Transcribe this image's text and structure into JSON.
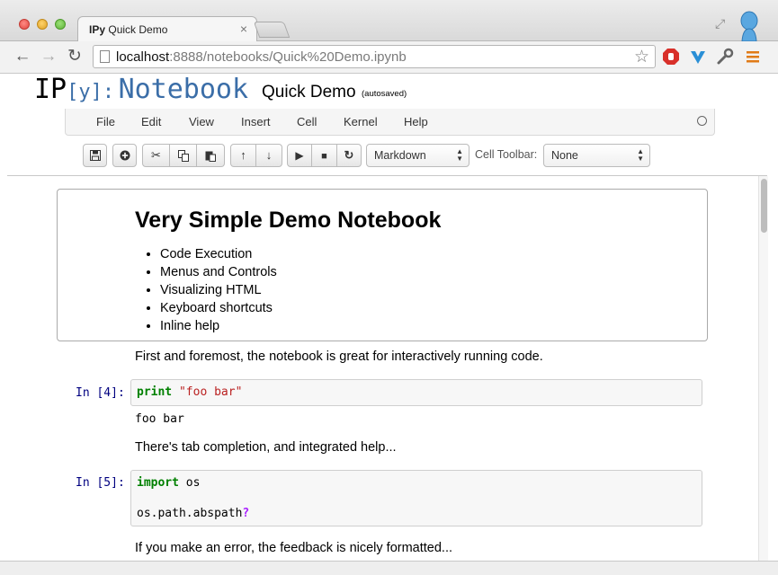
{
  "browser": {
    "tab": {
      "brand": "IPy",
      "title": "Quick Demo"
    },
    "url": {
      "host": "localhost",
      "rest": ":8888/notebooks/Quick%20Demo.ipynb"
    },
    "colors": {
      "close": "#e0443e",
      "minimize": "#dea123",
      "zoom": "#5fb13a"
    },
    "icons": [
      "back-icon",
      "forward-icon",
      "reload-icon",
      "bookmark-star-icon",
      "adblock-icon",
      "extension-v-icon",
      "wrench-icon",
      "chrome-menu-icon"
    ]
  },
  "header": {
    "logo_ip": "IP",
    "logo_y": "[y]:",
    "logo_notebook": "Notebook",
    "notebook_name": "Quick Demo",
    "save_status": "(autosaved)"
  },
  "menu": {
    "items": [
      "File",
      "Edit",
      "View",
      "Insert",
      "Cell",
      "Kernel",
      "Help"
    ]
  },
  "toolbar": {
    "cell_type": "Markdown",
    "cell_toolbar_label": "Cell Toolbar:",
    "cell_toolbar_value": "None"
  },
  "notebook": {
    "markdown_title": "Very Simple Demo Notebook",
    "markdown_list": [
      "Code Execution",
      "Menus and Controls",
      "Visualizing HTML",
      "Keyboard shortcuts",
      "Inline help"
    ],
    "text1": "First and foremost, the notebook is great for interactively running code.",
    "cell4": {
      "prompt": "In [4]:",
      "keyword": "print",
      "string": "\"foo bar\"",
      "output": "foo bar"
    },
    "text2": "There's tab completion, and integrated help...",
    "cell5": {
      "prompt": "In [5]:",
      "keyword": "import",
      "module": "os",
      "line2": "os.path.abspath",
      "help_op": "?"
    },
    "text3": "If you make an error, the feedback is nicely formatted..."
  }
}
